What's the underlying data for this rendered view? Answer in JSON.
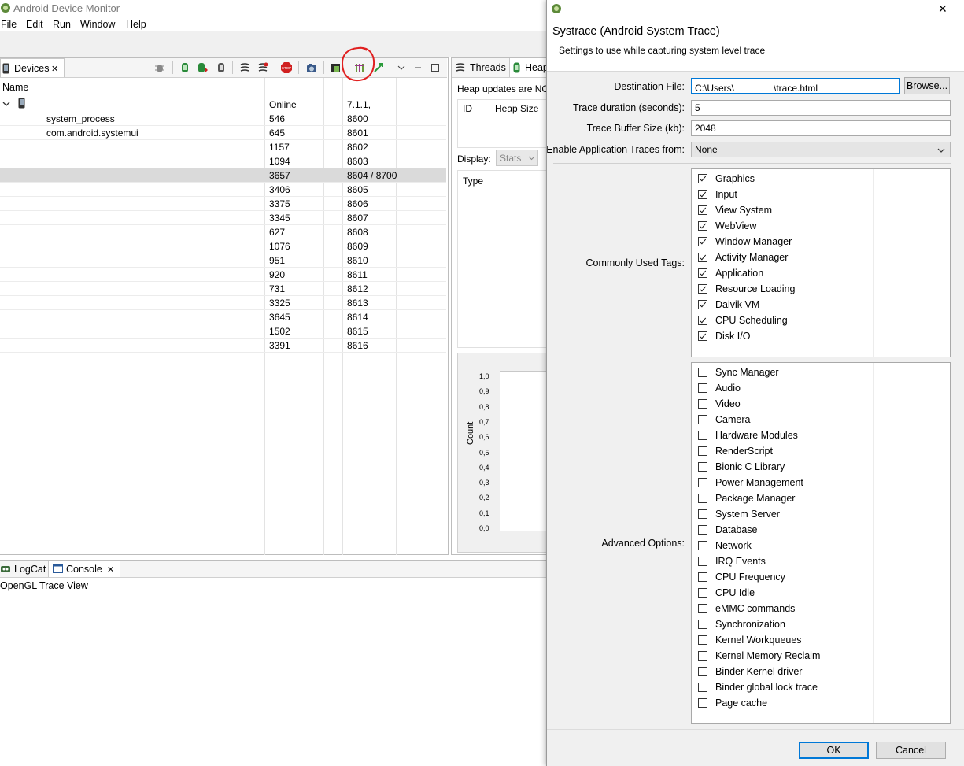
{
  "window": {
    "title": "Android Device Monitor"
  },
  "menu": [
    "File",
    "Edit",
    "Run",
    "Window",
    "Help"
  ],
  "devices_panel": {
    "tab_label": "Devices",
    "column_name": "Name",
    "device": {
      "status": "Online",
      "version": "7.1.1,"
    },
    "rows": [
      {
        "name": "system_process",
        "pid": "546",
        "port": "8600"
      },
      {
        "name": "com.android.systemui",
        "pid": "645",
        "port": "8601"
      },
      {
        "name": "",
        "pid": "1157",
        "port": "8602"
      },
      {
        "name": "",
        "pid": "1094",
        "port": "8603"
      },
      {
        "name": "",
        "pid": "3657",
        "port": "8604 / 8700"
      },
      {
        "name": "",
        "pid": "3406",
        "port": "8605"
      },
      {
        "name": "",
        "pid": "3375",
        "port": "8606"
      },
      {
        "name": "",
        "pid": "3345",
        "port": "8607"
      },
      {
        "name": "",
        "pid": "627",
        "port": "8608"
      },
      {
        "name": "",
        "pid": "1076",
        "port": "8609"
      },
      {
        "name": "",
        "pid": "951",
        "port": "8610"
      },
      {
        "name": "",
        "pid": "920",
        "port": "8611"
      },
      {
        "name": "",
        "pid": "731",
        "port": "8612"
      },
      {
        "name": "",
        "pid": "3325",
        "port": "8613"
      },
      {
        "name": "",
        "pid": "3645",
        "port": "8614"
      },
      {
        "name": "",
        "pid": "1502",
        "port": "8615"
      },
      {
        "name": "",
        "pid": "3391",
        "port": "8616"
      }
    ],
    "selected_row": 4,
    "stop_label": "STOP"
  },
  "heap_panel": {
    "tab_threads": "Threads",
    "tab_heap": "Heap",
    "notice": "Heap updates are NO",
    "col_id": "ID",
    "col_heap_size": "Heap Size",
    "display_label": "Display:",
    "display_value": "Stats",
    "type_label": "Type",
    "chart_ylabel": "Count",
    "chart_ticks": [
      "1,0",
      "0,9",
      "0,8",
      "0,7",
      "0,6",
      "0,5",
      "0,4",
      "0,3",
      "0,2",
      "0,1",
      "0,0"
    ]
  },
  "bottom_panel": {
    "tab_logcat": "LogCat",
    "tab_console": "Console",
    "content": "OpenGL Trace View"
  },
  "dialog": {
    "title": "Systrace (Android System Trace)",
    "subtitle": "Settings to use while capturing system level trace",
    "dest_label": "Destination File:",
    "dest_value_prefix": "C:\\Users\\",
    "dest_value_suffix": "\\trace.html",
    "browse_label": "Browse...",
    "duration_label": "Trace duration (seconds):",
    "duration_value": "5",
    "buffer_label": "Trace Buffer Size (kb):",
    "buffer_value": "2048",
    "app_traces_label": "Enable Application Traces from:",
    "app_traces_value": "None",
    "common_label": "Commonly Used Tags:",
    "common_tags": [
      {
        "label": "Graphics",
        "checked": true
      },
      {
        "label": "Input",
        "checked": true
      },
      {
        "label": "View System",
        "checked": true
      },
      {
        "label": "WebView",
        "checked": true
      },
      {
        "label": "Window Manager",
        "checked": true
      },
      {
        "label": "Activity Manager",
        "checked": true
      },
      {
        "label": "Application",
        "checked": true
      },
      {
        "label": "Resource Loading",
        "checked": true
      },
      {
        "label": "Dalvik VM",
        "checked": true
      },
      {
        "label": "CPU Scheduling",
        "checked": true
      },
      {
        "label": "Disk I/O",
        "checked": true
      }
    ],
    "advanced_label": "Advanced Options:",
    "advanced_tags": [
      {
        "label": "Sync Manager",
        "checked": false
      },
      {
        "label": "Audio",
        "checked": false
      },
      {
        "label": "Video",
        "checked": false
      },
      {
        "label": "Camera",
        "checked": false
      },
      {
        "label": "Hardware Modules",
        "checked": false
      },
      {
        "label": "RenderScript",
        "checked": false
      },
      {
        "label": "Bionic C Library",
        "checked": false
      },
      {
        "label": "Power Management",
        "checked": false
      },
      {
        "label": "Package Manager",
        "checked": false
      },
      {
        "label": "System Server",
        "checked": false
      },
      {
        "label": "Database",
        "checked": false
      },
      {
        "label": "Network",
        "checked": false
      },
      {
        "label": "IRQ Events",
        "checked": false
      },
      {
        "label": "CPU Frequency",
        "checked": false
      },
      {
        "label": "CPU Idle",
        "checked": false
      },
      {
        "label": "eMMC commands",
        "checked": false
      },
      {
        "label": "Synchronization",
        "checked": false
      },
      {
        "label": "Kernel Workqueues",
        "checked": false
      },
      {
        "label": "Kernel Memory Reclaim",
        "checked": false
      },
      {
        "label": "Binder Kernel driver",
        "checked": false
      },
      {
        "label": "Binder global lock trace",
        "checked": false
      },
      {
        "label": "Page cache",
        "checked": false
      }
    ],
    "ok_label": "OK",
    "cancel_label": "Cancel",
    "close_symbol": "✕"
  },
  "colors": {
    "annotation_circle": "#e02020",
    "ok_border": "#0078d7"
  }
}
